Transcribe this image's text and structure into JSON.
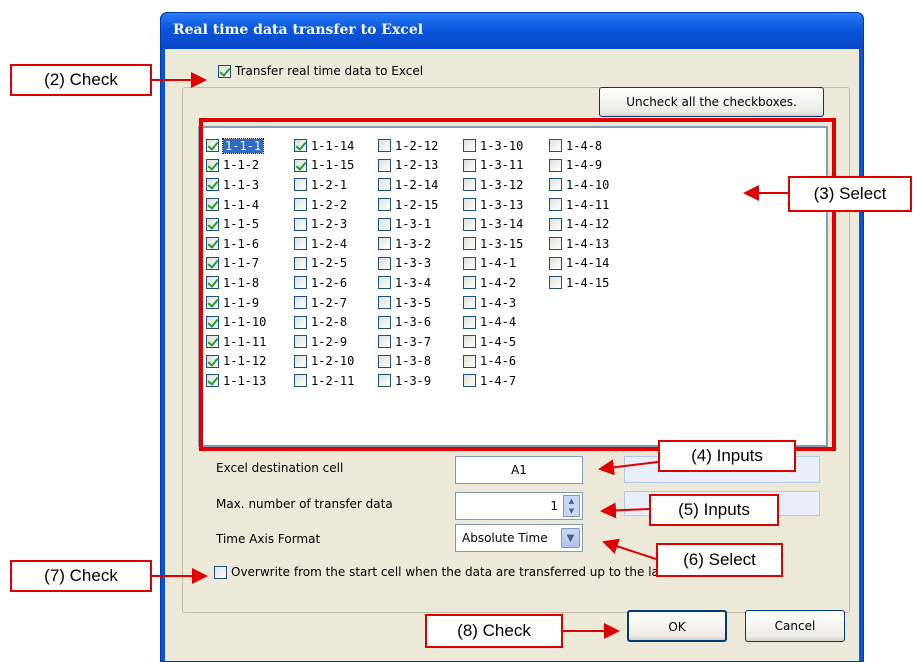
{
  "window": {
    "title": "Real time data transfer to Excel"
  },
  "transfer_checkbox": {
    "label": "Transfer real time data to Excel",
    "checked": true
  },
  "uncheck_all_button": {
    "label": "Uncheck all the checkboxes."
  },
  "channels": {
    "columns": [
      [
        {
          "id": "1-1-1",
          "checked": true,
          "selected": true
        },
        {
          "id": "1-1-2",
          "checked": true
        },
        {
          "id": "1-1-3",
          "checked": true
        },
        {
          "id": "1-1-4",
          "checked": true
        },
        {
          "id": "1-1-5",
          "checked": true
        },
        {
          "id": "1-1-6",
          "checked": true
        },
        {
          "id": "1-1-7",
          "checked": true
        },
        {
          "id": "1-1-8",
          "checked": true
        },
        {
          "id": "1-1-9",
          "checked": true
        },
        {
          "id": "1-1-10",
          "checked": true
        },
        {
          "id": "1-1-11",
          "checked": true
        },
        {
          "id": "1-1-12",
          "checked": true
        },
        {
          "id": "1-1-13",
          "checked": true
        }
      ],
      [
        {
          "id": "1-1-14",
          "checked": true
        },
        {
          "id": "1-1-15",
          "checked": true
        },
        {
          "id": "1-2-1",
          "checked": false
        },
        {
          "id": "1-2-2",
          "checked": false
        },
        {
          "id": "1-2-3",
          "checked": false
        },
        {
          "id": "1-2-4",
          "checked": false
        },
        {
          "id": "1-2-5",
          "checked": false
        },
        {
          "id": "1-2-6",
          "checked": false
        },
        {
          "id": "1-2-7",
          "checked": false
        },
        {
          "id": "1-2-8",
          "checked": false
        },
        {
          "id": "1-2-9",
          "checked": false
        },
        {
          "id": "1-2-10",
          "checked": false
        },
        {
          "id": "1-2-11",
          "checked": false
        }
      ],
      [
        {
          "id": "1-2-12",
          "checked": false
        },
        {
          "id": "1-2-13",
          "checked": false
        },
        {
          "id": "1-2-14",
          "checked": false
        },
        {
          "id": "1-2-15",
          "checked": false
        },
        {
          "id": "1-3-1",
          "checked": false
        },
        {
          "id": "1-3-2",
          "checked": false
        },
        {
          "id": "1-3-3",
          "checked": false
        },
        {
          "id": "1-3-4",
          "checked": false
        },
        {
          "id": "1-3-5",
          "checked": false
        },
        {
          "id": "1-3-6",
          "checked": false
        },
        {
          "id": "1-3-7",
          "checked": false
        },
        {
          "id": "1-3-8",
          "checked": false
        },
        {
          "id": "1-3-9",
          "checked": false
        }
      ],
      [
        {
          "id": "1-3-10",
          "checked": false
        },
        {
          "id": "1-3-11",
          "checked": false
        },
        {
          "id": "1-3-12",
          "checked": false
        },
        {
          "id": "1-3-13",
          "checked": false
        },
        {
          "id": "1-3-14",
          "checked": false
        },
        {
          "id": "1-3-15",
          "checked": false
        },
        {
          "id": "1-4-1",
          "checked": false
        },
        {
          "id": "1-4-2",
          "checked": false
        },
        {
          "id": "1-4-3",
          "checked": false
        },
        {
          "id": "1-4-4",
          "checked": false
        },
        {
          "id": "1-4-5",
          "checked": false
        },
        {
          "id": "1-4-6",
          "checked": false
        },
        {
          "id": "1-4-7",
          "checked": false
        }
      ],
      [
        {
          "id": "1-4-8",
          "checked": false
        },
        {
          "id": "1-4-9",
          "checked": false
        },
        {
          "id": "1-4-10",
          "checked": false
        },
        {
          "id": "1-4-11",
          "checked": false
        },
        {
          "id": "1-4-12",
          "checked": false
        },
        {
          "id": "1-4-13",
          "checked": false
        },
        {
          "id": "1-4-14",
          "checked": false
        },
        {
          "id": "1-4-15",
          "checked": false
        }
      ]
    ]
  },
  "fields": {
    "dest_cell_label": "Excel destination cell",
    "dest_cell_value": "A1",
    "max_transfer_label": "Max. number of transfer data",
    "max_transfer_value": "1",
    "time_axis_label": "Time Axis Format",
    "time_axis_value": "Absolute Time"
  },
  "overwrite_checkbox": {
    "label": "Overwrite from the start cell  when the data are transferred up to the last cell.",
    "checked": false
  },
  "buttons": {
    "ok": "OK",
    "cancel": "Cancel"
  },
  "callouts": {
    "c2": "(2) Check",
    "c3": "(3) Select",
    "c4": "(4) Inputs",
    "c5": "(5) Inputs",
    "c6": "(6) Select",
    "c7": "(7) Check",
    "c8": "(8) Check"
  },
  "colors": {
    "annotation_red": "#e00000",
    "titlebar_blue": "#0a55dd",
    "check_green": "#21a121"
  }
}
